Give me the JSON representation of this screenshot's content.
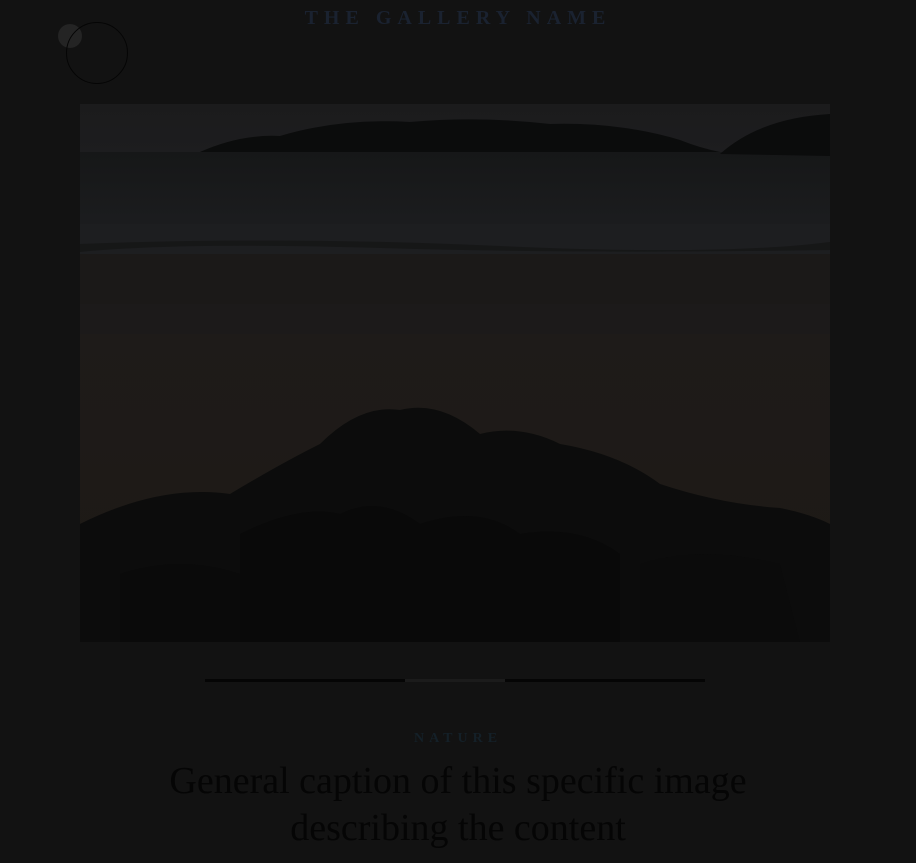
{
  "header": {
    "gallery_name": "THE GALLERY NAME"
  },
  "menu": {
    "icon": "circle-cursor-icon"
  },
  "slide": {
    "image_subject": "rocky shoreline with forested island at dusk",
    "progress": {
      "total_segments": 5,
      "active_index": 2
    }
  },
  "caption": {
    "category": "NATURE",
    "line1": "General caption of this specific image",
    "line2": "describing the content"
  },
  "colors": {
    "background": "#121212",
    "title": "#1a2230",
    "caption": "#050505"
  }
}
